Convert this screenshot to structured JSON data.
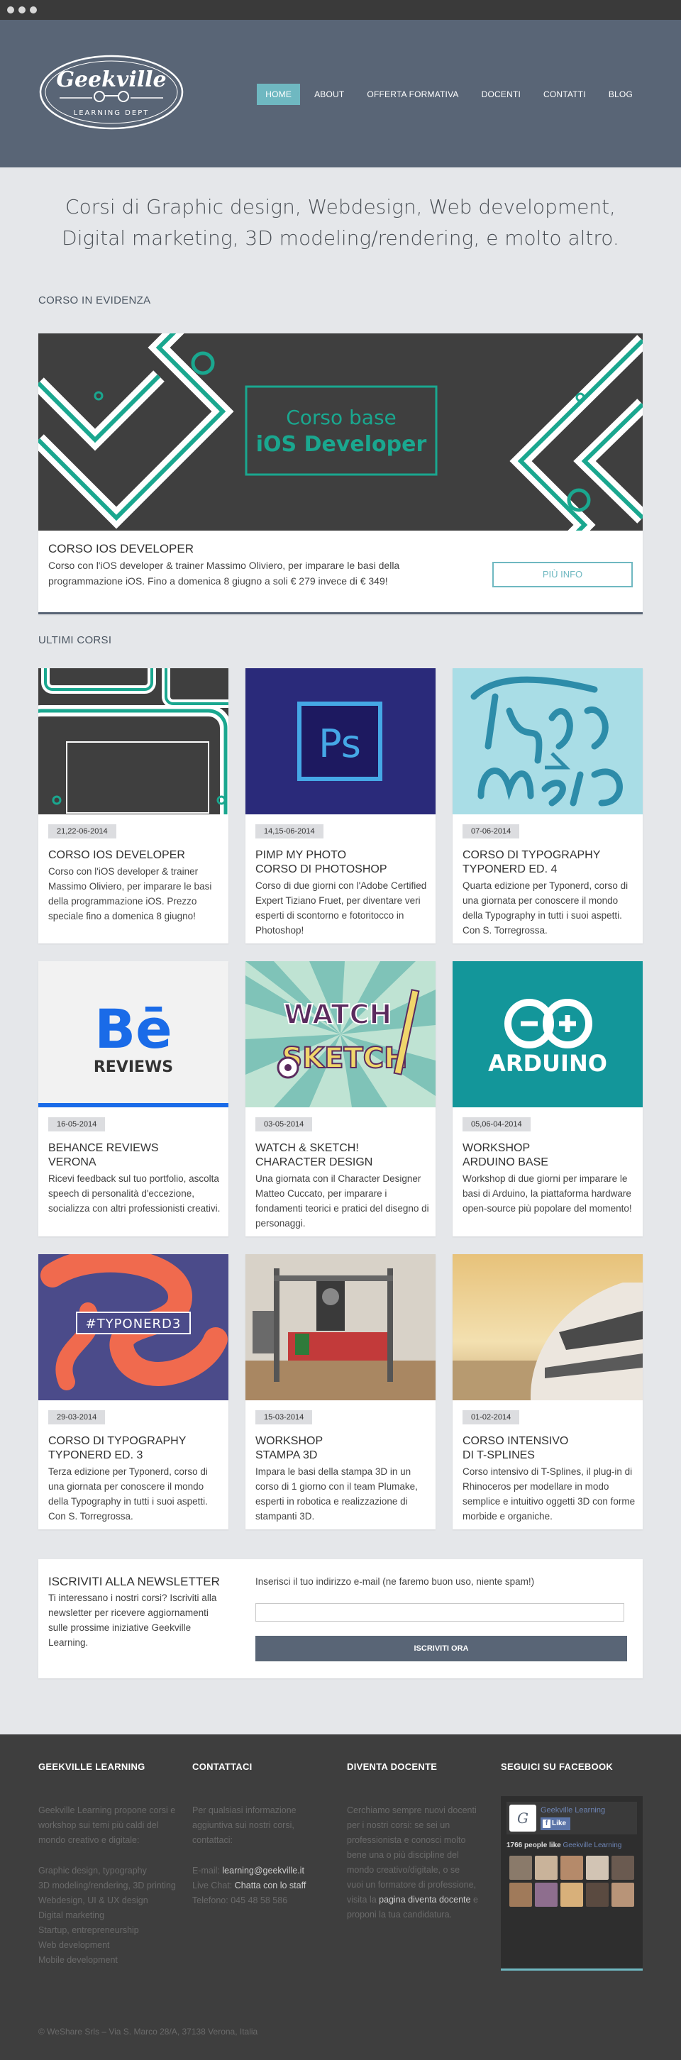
{
  "colors": {
    "header": "#596576",
    "accent": "#6fb8c1",
    "teal": "#1aa78f",
    "footer": "#3e3e3e"
  },
  "logo": {
    "name": "Geekville",
    "sub": "LEARNING DEPT"
  },
  "nav": [
    {
      "label": "HOME",
      "active": true
    },
    {
      "label": "ABOUT"
    },
    {
      "label": "OFFERTA FORMATIVA"
    },
    {
      "label": "DOCENTI"
    },
    {
      "label": "CONTATTI"
    },
    {
      "label": "BLOG"
    }
  ],
  "intro": {
    "line1": "Corsi di Graphic design, Webdesign, Web development,",
    "line2": "Digital marketing, 3D modeling/rendering, e molto altro."
  },
  "featured": {
    "section_title": "CORSO IN EVIDENZA",
    "image_line1": "Corso base",
    "image_line2": "iOS Developer",
    "title": "CORSO IOS DEVELOPER",
    "desc": "Corso con l'iOS developer & trainer Massimo Oliviero, per imparare le basi della programmazione iOS. Fino a domenica 8 giugno a soli € 279 invece di € 349!",
    "button": "PIÙ INFO"
  },
  "courses_title": "ULTIMI CORSI",
  "courses": [
    {
      "date": "21,22-06-2014",
      "title": "CORSO IOS DEVELOPER",
      "desc": "Corso con l'iOS developer & trainer Massimo Oliviero, per imparare le basi della programmazione iOS. Prezzo speciale fino a domenica 8 giugno!",
      "icon": "ipad-image"
    },
    {
      "date": "14,15-06-2014",
      "title": "PIMP MY PHOTO\nCORSO DI PHOTOSHOP",
      "desc": "Corso di due giorni con l'Adobe Certified Expert Tiziano Fruet, per diventare veri esperti di scontorno e fotoritocco in Photoshop!",
      "icon": "photoshop-logo",
      "image_text": "Ps"
    },
    {
      "date": "07-06-2014",
      "title": "CORSO DI TYPOGRAPHY\nTYPONERD ED. 4",
      "desc": "Quarta edizione per Typonerd, corso di una giornata per conoscere il mondo della Typography in tutti i suoi aspetti. Con S. Torregrossa.",
      "icon": "typo-nerd-lettering"
    },
    {
      "date": "16-05-2014",
      "title": "BEHANCE REVIEWS\nVERONA",
      "desc": "Ricevi feedback sul tuo portfolio, ascolta speech di personalità d'eccezione, socializza con altri professionisti creativi.",
      "icon": "behance-logo",
      "image_text": "Bē",
      "image_sub": "REVIEWS"
    },
    {
      "date": "03-05-2014",
      "title": "WATCH & SKETCH!\nCHARACTER DESIGN",
      "desc": "Una giornata con il Character Designer Matteo Cuccato, per imparare i fondamenti teorici e pratici del disegno di personaggi.",
      "icon": "watch-sketch-illustration",
      "image_line1": "WATCH",
      "image_line2": "SKETCH"
    },
    {
      "date": "05,06-04-2014",
      "title": "WORKSHOP\nARDUINO BASE",
      "desc": "Workshop di due giorni per imparare le basi di Arduino, la piattaforma hardware open-source più popolare del momento!",
      "icon": "arduino-logo",
      "image_text": "ARDUINO"
    },
    {
      "date": "29-03-2014",
      "title": "CORSO DI TYPOGRAPHY\nTYPONERD ED. 3",
      "desc": "Terza edizione per Typonerd, corso di una giornata per conoscere il mondo della Typography in tutti i suoi aspetti. Con S. Torregrossa.",
      "icon": "typonerd3-image",
      "image_text": "#TYPONERD3"
    },
    {
      "date": "15-03-2014",
      "title": "WORKSHOP\nSTAMPA 3D",
      "desc": "Impara le basi della stampa 3D in un corso di 1 giorno con il team Plumake, esperti in robotica e realizzazione di stampanti 3D.",
      "icon": "3d-printer-photo"
    },
    {
      "date": "01-02-2014",
      "title": "CORSO INTENSIVO\nDI T-SPLINES",
      "desc": "Corso intensivo di T-Splines, il plug-in di Rhinoceros per modellare in modo semplice e intuitivo oggetti 3D con forme morbide e organiche.",
      "icon": "yacht-render"
    }
  ],
  "newsletter": {
    "title": "ISCRIVITI ALLA NEWSLETTER",
    "desc": "Ti interessano i nostri corsi? Iscriviti alla newsletter per ricevere aggiornamenti sulle prossime iniziative Geekville Learning.",
    "label": "Inserisci il tuo indirizzo e-mail (ne faremo buon uso, niente spam!)",
    "input_value": "",
    "button": "ISCRIVITI ORA"
  },
  "footer": {
    "col1": {
      "title": "GEEKVILLE LEARNING",
      "text": "Geekville Learning propone corsi e workshop sui temi più caldi del mondo creativo e digitale:",
      "list": [
        "Graphic design, typography",
        "3D modeling/rendering, 3D printing",
        "Webdesign, UI & UX design",
        "Digital marketing",
        "Startup, entrepreneurship",
        "Web development",
        "Mobile development"
      ]
    },
    "col2": {
      "title": "CONTATTACI",
      "text": "Per qualsiasi informazione aggiuntiva sui nostri corsi, contattaci:",
      "email_label": "E-mail:",
      "email": "learning@geekville.it",
      "chat_label": "Live Chat:",
      "chat": "Chatta con lo staff",
      "phone_label": "Telefono:",
      "phone": "045 48 58 586"
    },
    "col3": {
      "title": "DIVENTA DOCENTE",
      "text_before": "Cerchiamo sempre nuovi docenti per i nostri corsi: se sei un professionista e conosci molto bene una o più discipline del mondo creativo/digitale, o se vuoi un formatore di professione, visita la",
      "link": "pagina diventa docente",
      "text_after": "e proponi la tua candidatura."
    },
    "col4": {
      "title": "SEGUICI SU FACEBOOK",
      "fb_name": "Geekville Learning",
      "fb_like": "Like",
      "fb_count": "1766 people like",
      "fb_page": "Geekville Learning"
    },
    "copyright": "© WeShare Srls – Via S. Marco 28/A, 37138 Verona, Italia"
  }
}
